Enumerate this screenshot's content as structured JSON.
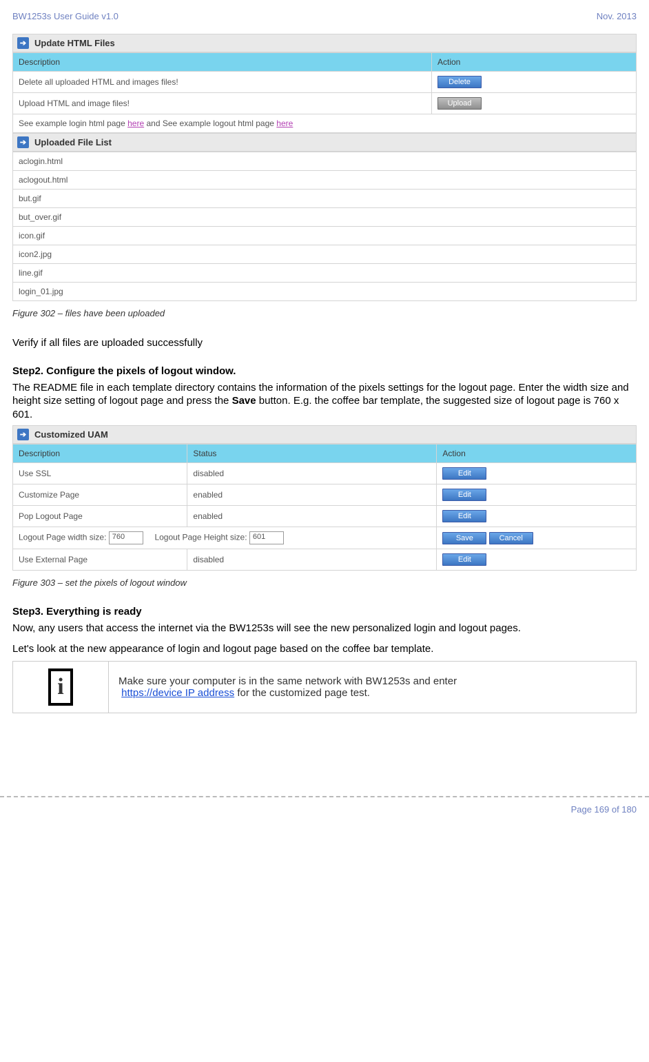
{
  "header": {
    "left": "BW1253s User Guide v1.0",
    "right": "Nov.  2013"
  },
  "panel1": {
    "title": "Update HTML Files",
    "headers": {
      "c1": "Description",
      "c2": "Action"
    },
    "row1": {
      "desc": "Delete all uploaded HTML and images files!",
      "btn": "Delete"
    },
    "row2": {
      "desc": "Upload HTML and image files!",
      "btn": "Upload"
    },
    "linkrow": {
      "t1": "See example login html page ",
      "l1": "here",
      "t2": " and See example logout html page ",
      "l2": "here"
    }
  },
  "panel2": {
    "title": "Uploaded File List",
    "files": [
      "aclogin.html",
      "aclogout.html",
      "but.gif",
      "but_over.gif",
      "icon.gif",
      "icon2.jpg",
      "line.gif",
      "login_01.jpg"
    ]
  },
  "fig302": "Figure 302  – files have been uploaded",
  "verify": "Verify if all files are uploaded successfully",
  "step2": {
    "title": "Step2. Configure the pixels of logout window.",
    "para": "The README file in each template directory contains the information of the pixels settings for the logout page. Enter the width size and height size setting of logout page and press the Save button. E.g. the coffee bar template, the suggested size of logout page is 760 x 601.",
    "para_p1": "The README file in each template directory contains the information of the pixels settings for the logout page. Enter the width size and height size setting of logout page and press the ",
    "para_bold": "Save",
    "para_p2": " button. E.g. the coffee bar template, the suggested size of logout page is 760 x 601."
  },
  "panel3": {
    "title": "Customized UAM",
    "headers": {
      "c1": "Description",
      "c2": "Status",
      "c3": "Action"
    },
    "rows": [
      {
        "desc": "Use SSL",
        "status": "disabled",
        "btn": "Edit"
      },
      {
        "desc": "Customize Page",
        "status": "enabled",
        "btn": "Edit"
      },
      {
        "desc": "Pop Logout Page",
        "status": "enabled",
        "btn": "Edit"
      }
    ],
    "sizeRow": {
      "l1": "Logout Page width size:",
      "v1": "760",
      "l2": "Logout Page Height size:",
      "v2": "601",
      "b1": "Save",
      "b2": "Cancel"
    },
    "lastRow": {
      "desc": "Use External Page",
      "status": "disabled",
      "btn": "Edit"
    }
  },
  "fig303": "Figure 303  – set the pixels of logout window",
  "step3": {
    "title": "Step3. Everything is ready",
    "p1": "Now, any users that access the internet via the BW1253s will see the new personalized login and logout pages.",
    "p2": "Let's look at the new appearance of login and logout page based on the coffee bar template."
  },
  "note": {
    "t1": "Make sure your computer is in the same network with BW1253s and enter",
    "link": "https://device IP address",
    "t2": " for the customized page test."
  },
  "footer": "Page 169 of 180"
}
